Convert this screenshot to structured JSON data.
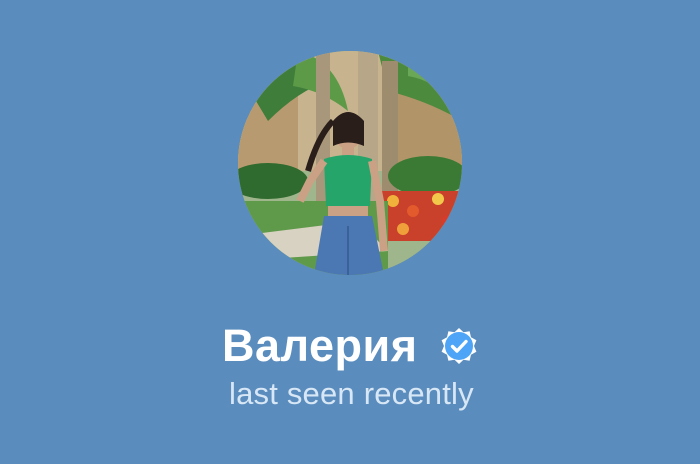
{
  "profile": {
    "name": "Валерия",
    "status": "last seen recently",
    "verified_icon": "verified-check-icon",
    "avatar_icon": "profile-photo"
  },
  "colors": {
    "background": "#5a8cbd",
    "name": "#ffffff",
    "status": "#d8e7f5",
    "badge": "#4ea4f6"
  }
}
